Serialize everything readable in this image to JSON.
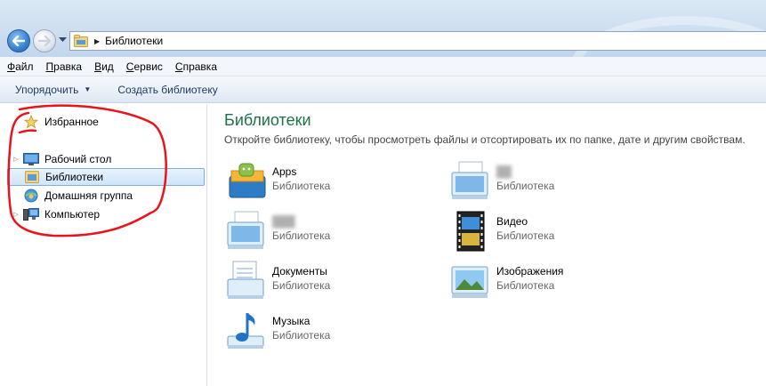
{
  "address": {
    "crumb": "Библиотеки"
  },
  "menu": [
    {
      "ul": "Ф",
      "rest": "айл"
    },
    {
      "ul": "П",
      "rest": "равка"
    },
    {
      "ul": "В",
      "rest": "ид"
    },
    {
      "ul": "С",
      "rest": "ервис"
    },
    {
      "ul": "С",
      "rest": "правка"
    }
  ],
  "commands": {
    "organize": "Упорядочить",
    "create_library": "Создать библиотеку"
  },
  "nav": {
    "favorites": "Избранное",
    "desktop": "Рабочий стол",
    "libraries": "Библиотеки",
    "homegroup": "Домашняя группа",
    "computer": "Компьютер"
  },
  "content": {
    "title": "Библиотеки",
    "subtitle": "Откройте библиотеку, чтобы просмотреть файлы и отсортировать их по папке, дате и другим свойствам.",
    "libraries": [
      {
        "name": "Apps",
        "type": "Библиотека",
        "icon": "apps-icon"
      },
      {
        "name": "██",
        "type": "Библиотека",
        "icon": "library-icon",
        "blurred": true
      },
      {
        "name": "███",
        "type": "Библиотека",
        "icon": "library-icon",
        "blurred": true
      },
      {
        "name": "Видео",
        "type": "Библиотека",
        "icon": "video-icon"
      },
      {
        "name": "Документы",
        "type": "Библиотека",
        "icon": "documents-icon"
      },
      {
        "name": "Изображения",
        "type": "Библиотека",
        "icon": "pictures-icon"
      },
      {
        "name": "Музыка",
        "type": "Библиотека",
        "icon": "music-icon"
      }
    ]
  },
  "colors": {
    "title_green": "#1e7145",
    "annotation_red": "#e8141b",
    "selection_border": "#84acdd"
  }
}
